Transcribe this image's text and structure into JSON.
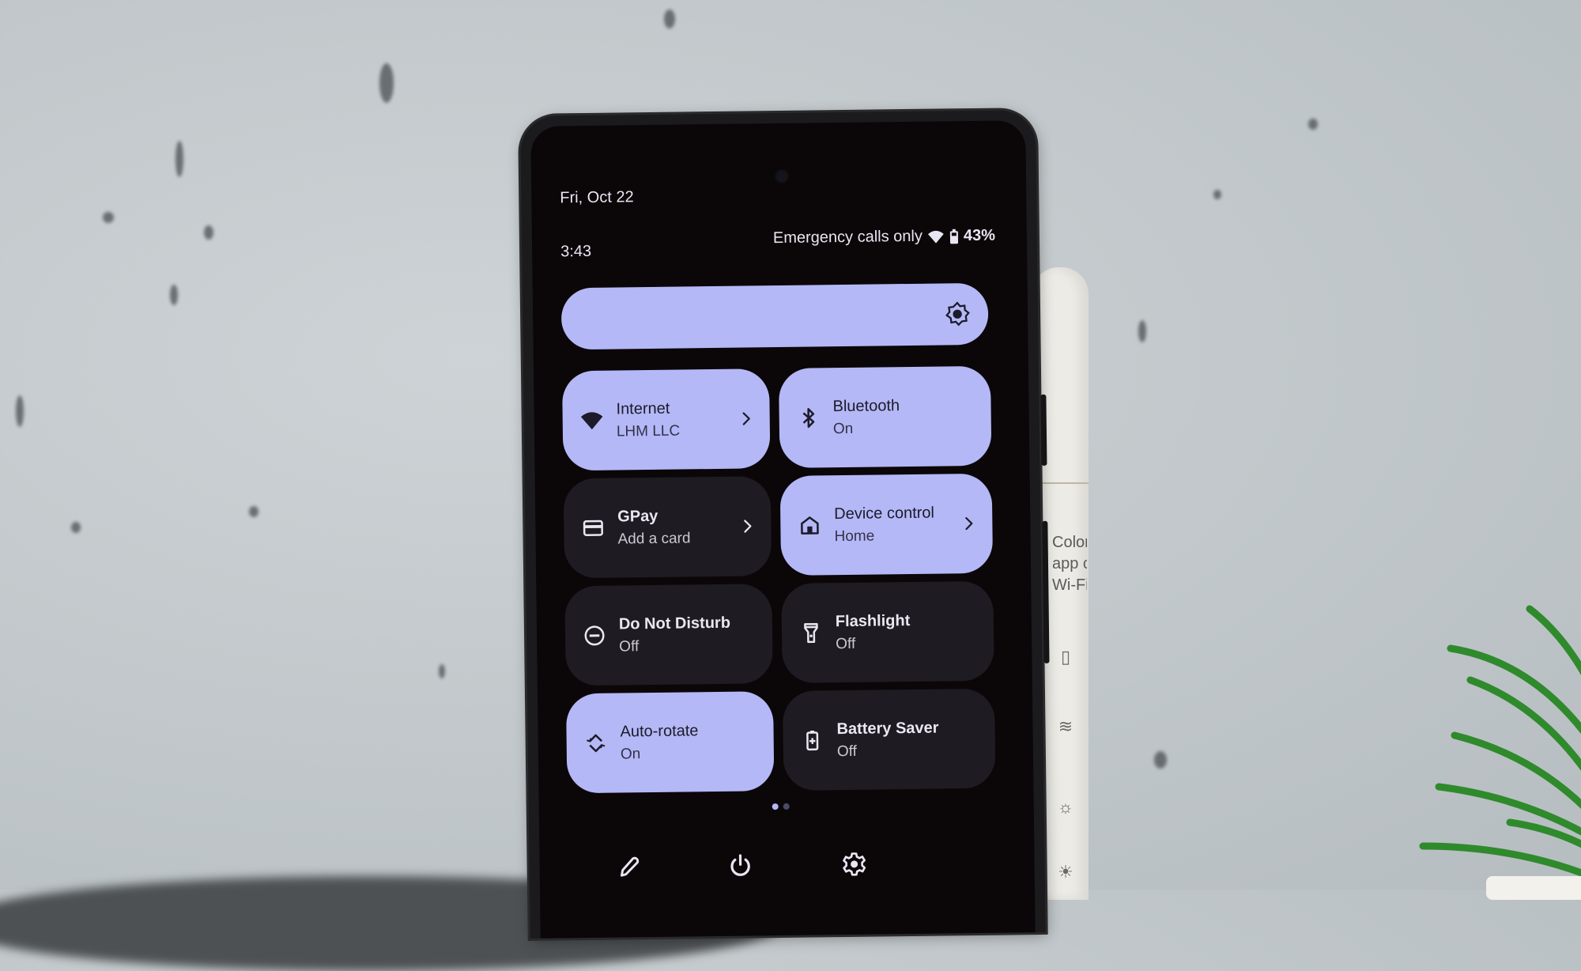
{
  "status_bar": {
    "date": "Fri, Oct 22",
    "time": "3:43",
    "carrier_text": "Emergency calls only",
    "wifi_icon": "wifi-icon",
    "battery_icon": "battery-icon",
    "battery_percent": "43%"
  },
  "brightness_slider": {
    "icon": "brightness-icon",
    "level": 1.0
  },
  "tiles": [
    {
      "title": "Internet",
      "subtitle": "LHM LLC",
      "icon": "wifi-icon",
      "state": "on",
      "has_chevron": true
    },
    {
      "title": "Bluetooth",
      "subtitle": "On",
      "icon": "bluetooth-icon",
      "state": "on",
      "has_chevron": false
    },
    {
      "title": "GPay",
      "subtitle": "Add a card",
      "icon": "credit-card-icon",
      "state": "off",
      "has_chevron": true
    },
    {
      "title": "Device control",
      "subtitle": "Home",
      "icon": "home-icon",
      "state": "on",
      "has_chevron": true
    },
    {
      "title": "Do Not Disturb",
      "subtitle": "Off",
      "icon": "do-not-disturb-icon",
      "state": "off",
      "has_chevron": false
    },
    {
      "title": "Flashlight",
      "subtitle": "Off",
      "icon": "flashlight-icon",
      "state": "off",
      "has_chevron": false
    },
    {
      "title": "Auto-rotate",
      "subtitle": "On",
      "icon": "auto-rotate-icon",
      "state": "on",
      "has_chevron": false
    },
    {
      "title": "Battery Saver",
      "subtitle": "Off",
      "icon": "battery-saver-icon",
      "state": "off",
      "has_chevron": false
    }
  ],
  "pager": {
    "pages": 2,
    "current": 1
  },
  "footer": {
    "edit_icon": "pencil-icon",
    "power_icon": "power-icon",
    "settings_icon": "gear-icon"
  },
  "background_box": {
    "text_lines": [
      "Color cha",
      "app con",
      "Wi-Fi lig"
    ]
  },
  "colors": {
    "tile_on": "#b5b8f6",
    "tile_off": "#1e1b22",
    "screen_bg": "#0b0709",
    "text_light": "#e9e6f3",
    "text_dark": "#1b1b2a"
  }
}
